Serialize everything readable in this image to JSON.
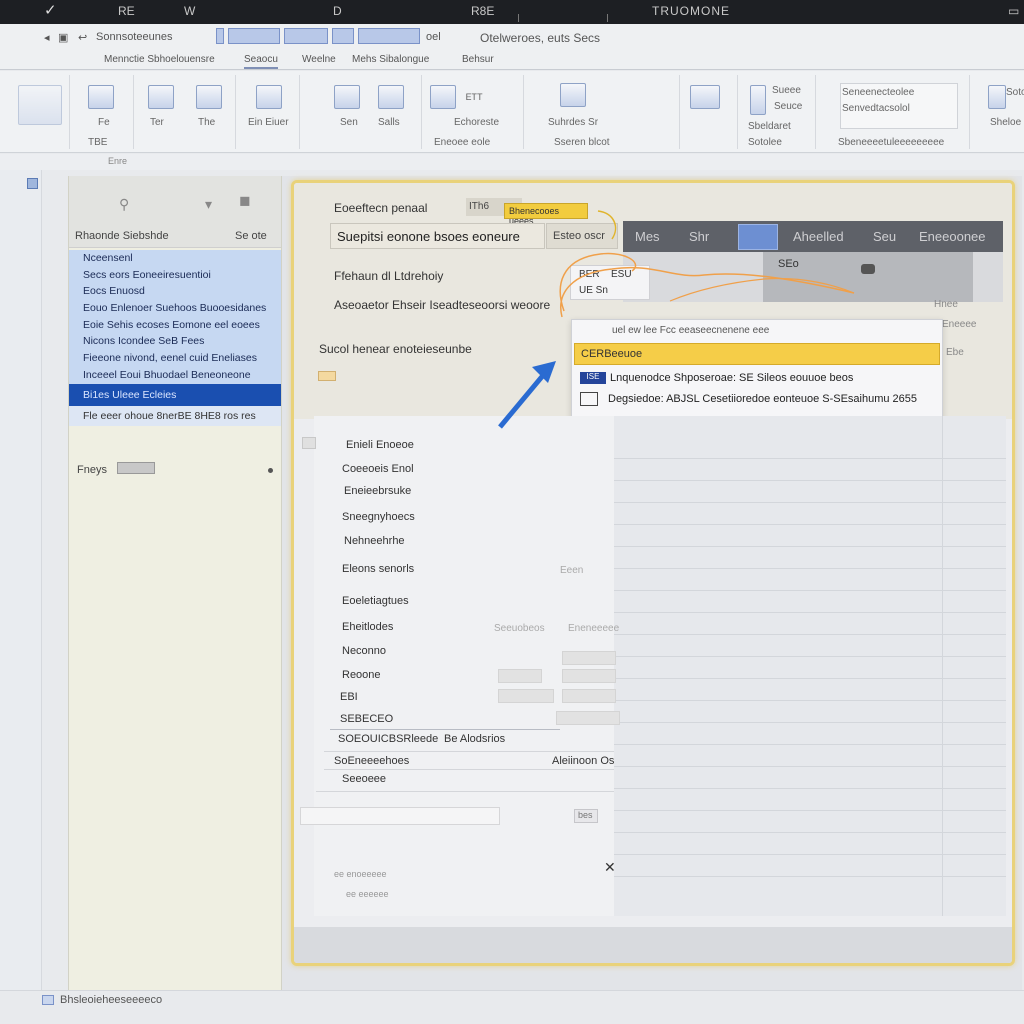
{
  "titlebar": {
    "check_glyph": "✓",
    "items": [
      "RE",
      "W",
      "D",
      "R8E"
    ],
    "title": "TRUOMONE"
  },
  "qat": {
    "left_label": "Sonnsoteeunes",
    "right_label": "Otelweroes, euts Secs",
    "extra": "oel"
  },
  "tabs": [
    "Mennctie Sbhoelouensre",
    "Seaocu",
    "Weelne",
    "Mehs Sibalongue",
    "Behsur"
  ],
  "ribbon": {
    "groups": [
      {
        "labels": [
          "",
          ""
        ]
      },
      {
        "labels": [
          "Fe",
          "TBE"
        ]
      },
      {
        "labels": [
          "Ter",
          "The"
        ]
      },
      {
        "labels": [
          "Ein Eiuer",
          ""
        ]
      },
      {
        "labels": [
          "Sen",
          "Salls"
        ]
      },
      {
        "labels": [
          "Echoreste",
          "Eneoee eole"
        ]
      },
      {
        "labels": [
          "Suhrdes Sr",
          "Sseren blcot"
        ]
      },
      {
        "labels": [
          "Sotolee",
          "Sbeldaret"
        ]
      },
      {
        "labels": [
          "Sueee",
          "Seuce"
        ]
      },
      {
        "labels": [
          "Seneenecteolee",
          "Senvedtacsolol"
        ]
      },
      {
        "labels": [
          "Sotou",
          "Sheloe"
        ]
      }
    ],
    "ribbon_caption": "Sbeneeeetuleeeeeeeee"
  },
  "formula": {
    "label": "Enre"
  },
  "nav": {
    "title": "Rhaonde Siebshde",
    "action": "Se ote",
    "items": [
      {
        "label": "Nceensenl"
      },
      {
        "label": "Secs eors Eoneeiresuentioi"
      },
      {
        "label": "Eocs Enuosd"
      },
      {
        "label": "Eouo Enlenoer Suehoos Buooesidanes"
      },
      {
        "label": "Eoie Sehis ecoses Eomone eel eoees"
      },
      {
        "label": "Nicons Icondee SeB Fees"
      },
      {
        "label": "Fieeone nivond, eenel cuid Eneliases"
      },
      {
        "label": "Inceeel Eoui Bhuodael Beneoneone"
      }
    ],
    "selected": {
      "label": "Bi1es Uleee Ecleies"
    },
    "last": {
      "label": "Fle eeer ohoue 8nerBE 8HE8 ros res"
    },
    "field_label": "Fneys"
  },
  "dialog": {
    "label1": "Eoeeftecn penaal",
    "inline_box": "ITh6",
    "tooltip": "Bhenecooes ueees",
    "field_value": "Suepitsi eonone bsoes eoneure",
    "field_btn": "Esteo oscr",
    "text1": "Ffehaun dl Ltdrehoiy",
    "text2": "Aseoaetor Ehseir Iseadteseoorsi weoore",
    "text3": "Sucol henear enoteieseunbe",
    "grid_header": [
      "Mes",
      "Shr",
      "",
      "Aheelled",
      "Seu",
      "Eneeoonee"
    ],
    "subhead": "SEo",
    "grid_right": [
      "Hnee",
      "Eneeee",
      "Ebe"
    ],
    "menu_items": [
      "BER",
      "ESU",
      "UE Sn"
    ],
    "popup": {
      "head": "uel ew lee Fcc eeaseecnenene eee",
      "selected": "CERBeeuoe",
      "row1_icon": "ISE",
      "row1": "Lnquenodce Shposeroae: SE Sileos eouuoe beos",
      "row2": "Degsiedoe: ABJSL Cesetiioredoe eonteuoe S-SEsaihumu 2655"
    },
    "lower_items": [
      "Enieli Enoeoe",
      "Coeeoeis Enol",
      "Eneieebrsuke",
      "Sneegnyhoecs",
      "Nehneehrhe",
      "Eleons senorls",
      "Eoeletiagtues",
      "Eheitlodes",
      "Neconno",
      "Reoone",
      "EBI",
      "SEBECEO",
      "SOEOUICBSRleede",
      "SoEneeeehoes",
      "Seeoeee"
    ],
    "lower_right": {
      "r1": "Eeen",
      "r2": "Seeuobeos",
      "r3": "Eneneeeee",
      "r4": "Be Alodsrios",
      "r5": "Aleiinoon Os"
    },
    "footer_btn": "bes",
    "footer_glyph": "✕",
    "footer_text": "ee enoeeeee",
    "footer_text2": "ee eeeeee"
  },
  "status": {
    "text": "Bhsleoieheeseeeeco"
  }
}
